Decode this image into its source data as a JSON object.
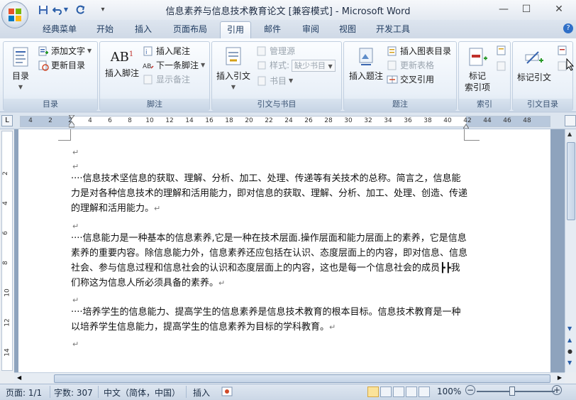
{
  "window": {
    "title": "信息素养与信息技术教育论文 [兼容模式] - Microsoft Word",
    "minimize_icon": "minimize-icon",
    "maximize_icon": "maximize-icon",
    "close_icon": "close-icon"
  },
  "quick_access": {
    "save": "save-icon",
    "undo": "undo-icon",
    "redo": "redo-icon",
    "customize": "customize-qat-icon"
  },
  "tabs": [
    "经典菜单",
    "开始",
    "插入",
    "页面布局",
    "引用",
    "邮件",
    "审阅",
    "视图",
    "开发工具"
  ],
  "active_tab": "引用",
  "ribbon": {
    "toc": {
      "label": "目录",
      "toc_button": "目录",
      "add_text": "添加文字",
      "update_toc": "更新目录"
    },
    "footnotes": {
      "label": "脚注",
      "insert_footnote": "插入脚注",
      "insert_endnote": "插入尾注",
      "next_footnote": "下一条脚注",
      "show_notes": "显示备注",
      "ab_glyph": "AB"
    },
    "citations": {
      "label": "引文与书目",
      "insert_citation": "插入引文",
      "manage_sources": "管理源",
      "style_label": "样式:",
      "style_value": "缺少书目",
      "bibliography": "书目"
    },
    "captions": {
      "label": "题注",
      "insert_caption": "插入题注",
      "insert_table_of_figures": "插入图表目录",
      "update_table": "更新表格",
      "cross_reference": "交叉引用"
    },
    "index": {
      "label": "索引",
      "mark_entry": "标记\n索引项"
    },
    "toa": {
      "label": "引文目录",
      "mark_citation": "标记引文"
    }
  },
  "ruler": {
    "h_numbers": [
      "4",
      "2",
      "2",
      "4",
      "6",
      "8",
      "10",
      "12",
      "14",
      "16",
      "18",
      "20",
      "22",
      "24",
      "26",
      "28",
      "30",
      "32",
      "34",
      "36",
      "38",
      "40",
      "42",
      "44",
      "46",
      "48"
    ],
    "v_numbers": [
      "2",
      "4",
      "6",
      "8",
      "10",
      "12",
      "14"
    ]
  },
  "document": {
    "paragraphs": [
      "····信息技术坚信息的获取、理解、分析、加工、处理、传递等有关技术的总称。简言之，信息能力是对各种信息技术的理解和活用能力，即对信息的获取、理解、分析、加工、处理、创造、传递的理解和活用能力。",
      "····信息能力是一种基本的信息素养,它是一种在技术层面.操作层面和能力层面上的素养，它是信息素养的重要内容。除信息能力外，信息素养还应包括在认识、态度层面上的内容，即对信息、信息社会、参与信息过程和信息社会的认识和态度层面上的内容，这也是每一个信息社会的成员┣┣我们称这为信息人所必须具备的素养。",
      "····培养学生的信息能力、提高学生的信息素养是信息技术教育的根本目标。信息技术教育是一种以培养学生信息能力，提高学生的信息素养为目标的学科教育。"
    ],
    "paragraph_mark": "↵"
  },
  "statusbar": {
    "page": "页面: 1/1",
    "words": "字数: 307",
    "language": "中文（简体，中国）",
    "mode": "插入",
    "zoom": "100%",
    "zoom_minus": "−",
    "zoom_plus": "+",
    "zoom_level": 1.0
  },
  "colors": {
    "ribbon_accent": "#2a5ea8",
    "active_view": "#fbe39a"
  }
}
